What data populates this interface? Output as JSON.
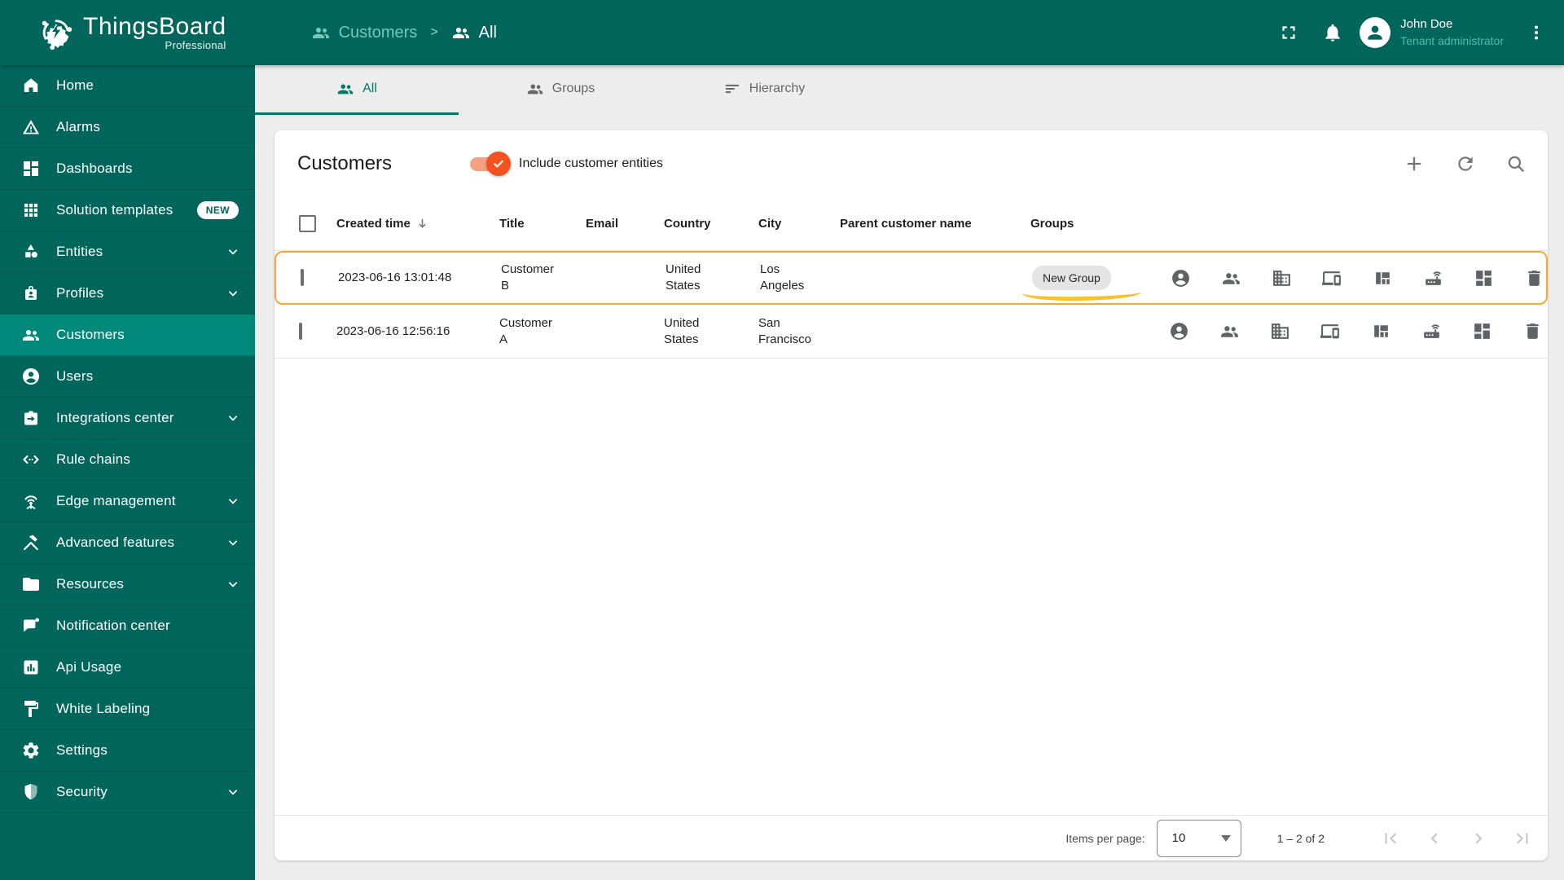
{
  "topbar": {
    "brand": "ThingsBoard",
    "brand_sub": "Professional",
    "separator": ">",
    "breadcrumb": [
      {
        "label": "Customers"
      },
      {
        "label": "All"
      }
    ],
    "icons": [
      "people-icon",
      "fullscreen-icon",
      "bell-icon",
      "avatar-icon",
      "kebab-menu-icon"
    ],
    "user": {
      "name": "John Doe",
      "role": "Tenant administrator"
    }
  },
  "sidebar": {
    "items": [
      {
        "label": "Home",
        "icon": "home-icon"
      },
      {
        "label": "Alarms",
        "icon": "warning-icon"
      },
      {
        "label": "Dashboards",
        "icon": "dashboard-icon"
      },
      {
        "label": "Solution templates",
        "icon": "grid-icon",
        "badge": "NEW"
      },
      {
        "label": "Entities",
        "icon": "shapes-icon",
        "expandable": true
      },
      {
        "label": "Profiles",
        "icon": "badge-icon",
        "expandable": true
      },
      {
        "label": "Customers",
        "icon": "people-icon",
        "active": true
      },
      {
        "label": "Users",
        "icon": "person-circle-icon"
      },
      {
        "label": "Integrations center",
        "icon": "integration-icon",
        "expandable": true
      },
      {
        "label": "Rule chains",
        "icon": "rule-chain-icon"
      },
      {
        "label": "Edge management",
        "icon": "antenna-icon",
        "expandable": true
      },
      {
        "label": "Advanced features",
        "icon": "tools-icon",
        "expandable": true
      },
      {
        "label": "Resources",
        "icon": "folder-icon",
        "expandable": true
      },
      {
        "label": "Notification center",
        "icon": "message-icon"
      },
      {
        "label": "Api Usage",
        "icon": "chart-box-icon"
      },
      {
        "label": "White Labeling",
        "icon": "paint-icon"
      },
      {
        "label": "Settings",
        "icon": "gear-icon"
      },
      {
        "label": "Security",
        "icon": "shield-icon",
        "expandable": true
      }
    ]
  },
  "tabs": [
    {
      "label": "All",
      "icon": "people-icon",
      "active": true
    },
    {
      "label": "Groups",
      "icon": "people-icon",
      "active": false
    },
    {
      "label": "Hierarchy",
      "icon": "hierarchy-icon",
      "active": false
    }
  ],
  "panel": {
    "title": "Customers",
    "toggle_label": "Include customer entities",
    "toggle_on": true,
    "header_icons": [
      "add-icon",
      "refresh-icon",
      "search-icon"
    ]
  },
  "table": {
    "sort": {
      "column": "Created time",
      "direction": "desc"
    },
    "columns": [
      "Created time",
      "Title",
      "Email",
      "Country",
      "City",
      "Parent customer name",
      "Groups"
    ],
    "rows": [
      {
        "created": "2023-06-16 13:01:48",
        "title": "Customer B",
        "email": "",
        "country": "United States",
        "city": "Los Angeles",
        "parent": "",
        "group_chip": "New Group",
        "highlighted": true
      },
      {
        "created": "2023-06-16 12:56:16",
        "title": "Customer A",
        "email": "",
        "country": "United States",
        "city": "San Francisco",
        "parent": "",
        "group_chip": "",
        "highlighted": false
      }
    ],
    "row_action_icons": [
      "manage-users-icon",
      "manage-customers-icon",
      "manage-assets-icon",
      "manage-devices-icon",
      "manage-entity-views-icon",
      "manage-edges-icon",
      "manage-dashboards-icon",
      "delete-icon"
    ]
  },
  "pagination": {
    "items_per_page_label": "Items per page:",
    "items_per_page": "10",
    "range": "1 – 2 of 2",
    "first_disabled": true,
    "prev_disabled": true,
    "next_disabled": true,
    "last_disabled": true
  },
  "colors": {
    "topbar": "#00665c",
    "sidebar_active": "#00897b",
    "tab_active": "#00796b",
    "toggle_orange": "#f4511e",
    "highlight_border": "#f2a63b",
    "swoosh": "#fbc12d"
  }
}
